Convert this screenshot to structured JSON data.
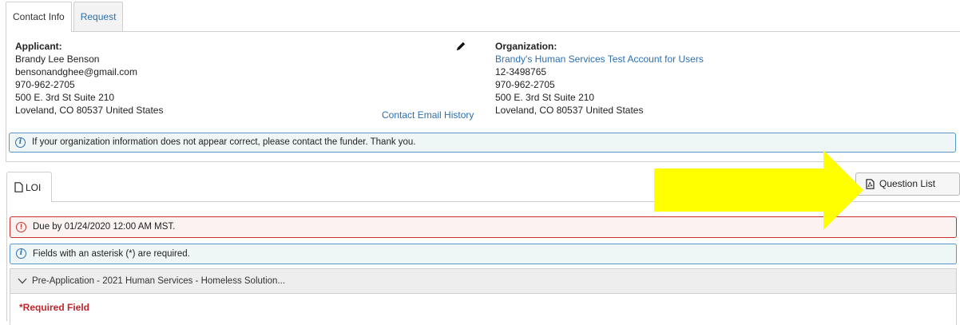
{
  "tabs": [
    {
      "label": "Contact Info",
      "active": true
    },
    {
      "label": "Request",
      "active": false
    }
  ],
  "applicant": {
    "header": "Applicant:",
    "name": "Brandy Lee Benson",
    "email": "bensonandghee@gmail.com",
    "phone": "970-962-2705",
    "address1": "500 E. 3rd St Suite 210",
    "address2": "Loveland, CO 80537 United States"
  },
  "contact_email_history": "Contact Email History",
  "organization": {
    "header": "Organization:",
    "name": "Brandy's Human Services Test Account for Users",
    "ein": "12-3498765",
    "phone": "970-962-2705",
    "address1": "500 E. 3rd St Suite 210",
    "address2": "Loveland, CO 80537 United States"
  },
  "org_info_alert": "If your organization information does not appear correct, please contact the funder. Thank you.",
  "loi_tab": {
    "label": "LOI",
    "icon": "document-icon"
  },
  "question_list_button": {
    "label": "Question List",
    "icon": "pdf-icon"
  },
  "annotation_arrow": {
    "color": "#ffff00",
    "direction": "right"
  },
  "due_alert": "Due by 01/24/2020 12:00 AM MST.",
  "asterisk_alert": "Fields with an asterisk (*) are required.",
  "section": {
    "title": "Pre-Application - 2021 Human Services - Homeless Solution...",
    "icon": "chevron-down-icon"
  },
  "required_field": "*Required Field",
  "colors": {
    "link": "#2f6fb0",
    "danger": "#c9302c",
    "info_border": "#5b95c9",
    "required": "#c0262c"
  }
}
